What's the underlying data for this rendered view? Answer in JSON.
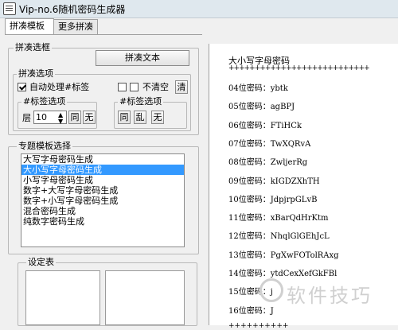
{
  "window": {
    "title": "Vip-no.6随机密码生成器"
  },
  "tabs": [
    {
      "label": "拼凑模板"
    },
    {
      "label": "更多拼凑"
    }
  ],
  "assemble": {
    "group_title": "拼凑选框",
    "button_label": "拼凑文本",
    "options_title": "拼凑选项",
    "auto_hash_label": "自动处理#标签",
    "auto_hash_checked": true,
    "no_clear_label": "不清空",
    "clear_button": "清",
    "hash_left_title": "#标签选项",
    "layer_label": "层",
    "layer_value": "10",
    "same_button": "同",
    "none_button_1": "无",
    "hash_right_title": "#标签选项",
    "same_button_2": "同",
    "random_button": "乱",
    "none_button_2": "无"
  },
  "template": {
    "group_title": "专题模板选择",
    "items": [
      "大写字母密码生成",
      "大小写字母密码生成",
      "小写字母密码生成",
      "数字+大写字母密码生成",
      "数字+小写字母密码生成",
      "混合密码生成",
      "纯数字密码生成"
    ],
    "selected_index": 1
  },
  "settings": {
    "group_title": "设定表"
  },
  "output": {
    "header": "大小写字母密码",
    "separator": "+++++++++++++++++++++++++++",
    "lines": [
      "04位密码：ybtk",
      "05位密码：agBPJ",
      "06位密码：FTiHCk",
      "07位密码：TwXQRvA",
      "08位密码：ZwljerRg",
      "09位密码：kIGDZXhTH",
      "10位密码：JdpjrpGLvB",
      "11位密码：xBarQdHrKtm",
      "12位密码：NhqlGlGEhJcL",
      "13位密码：PgXwFOTolRAxg",
      "14位密码：ytdCexXefGkFBl",
      "15位密码：j",
      "16位密码：J"
    ],
    "footer_separator": "++++++++++"
  },
  "watermark": {
    "text": "软件技巧"
  }
}
